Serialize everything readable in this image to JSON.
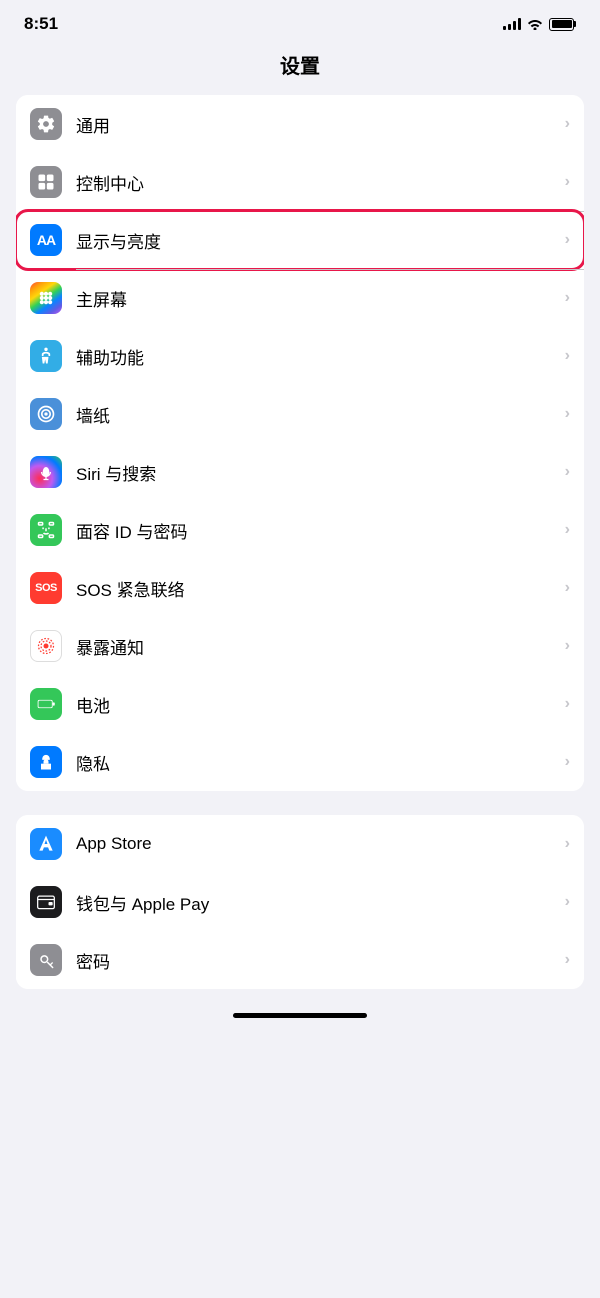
{
  "statusBar": {
    "time": "8:51",
    "timeAriaLabel": "time"
  },
  "pageTitle": "设置",
  "groups": [
    {
      "id": "group1",
      "items": [
        {
          "id": "general",
          "label": "通用",
          "iconBg": "icon-gray",
          "iconType": "gear",
          "highlighted": false
        },
        {
          "id": "control-center",
          "label": "控制中心",
          "iconBg": "icon-gray2",
          "iconType": "toggles",
          "highlighted": false
        },
        {
          "id": "display-brightness",
          "label": "显示与亮度",
          "iconBg": "icon-blue",
          "iconType": "aa",
          "highlighted": true
        },
        {
          "id": "home-screen",
          "label": "主屏幕",
          "iconBg": "icon-colorful",
          "iconType": "grid",
          "highlighted": false
        },
        {
          "id": "accessibility",
          "label": "辅助功能",
          "iconBg": "icon-cyan",
          "iconType": "person",
          "highlighted": false
        },
        {
          "id": "wallpaper",
          "label": "墙纸",
          "iconBg": "icon-blue2",
          "iconType": "flower",
          "highlighted": false
        },
        {
          "id": "siri",
          "label": "Siri 与搜索",
          "iconBg": "icon-siri",
          "iconType": "siri",
          "highlighted": false
        },
        {
          "id": "faceid",
          "label": "面容 ID 与密码",
          "iconBg": "icon-green",
          "iconType": "faceid",
          "highlighted": false
        },
        {
          "id": "sos",
          "label": "SOS 紧急联络",
          "iconBg": "icon-red",
          "iconType": "sos",
          "highlighted": false
        },
        {
          "id": "exposure",
          "label": "暴露通知",
          "iconBg": "icon-orange-dots",
          "iconType": "exposure",
          "highlighted": false
        },
        {
          "id": "battery",
          "label": "电池",
          "iconBg": "icon-green2",
          "iconType": "battery",
          "highlighted": false
        },
        {
          "id": "privacy",
          "label": "隐私",
          "iconBg": "icon-blue3",
          "iconType": "hand",
          "highlighted": false
        }
      ]
    },
    {
      "id": "group2",
      "items": [
        {
          "id": "appstore",
          "label": "App Store",
          "iconBg": "icon-appstore",
          "iconType": "appstore",
          "highlighted": false
        },
        {
          "id": "wallet",
          "label": "钱包与 Apple Pay",
          "iconBg": "icon-wallet",
          "iconType": "wallet",
          "highlighted": false
        },
        {
          "id": "passwords",
          "label": "密码",
          "iconBg": "icon-passwords",
          "iconType": "key",
          "highlighted": false
        }
      ]
    }
  ]
}
